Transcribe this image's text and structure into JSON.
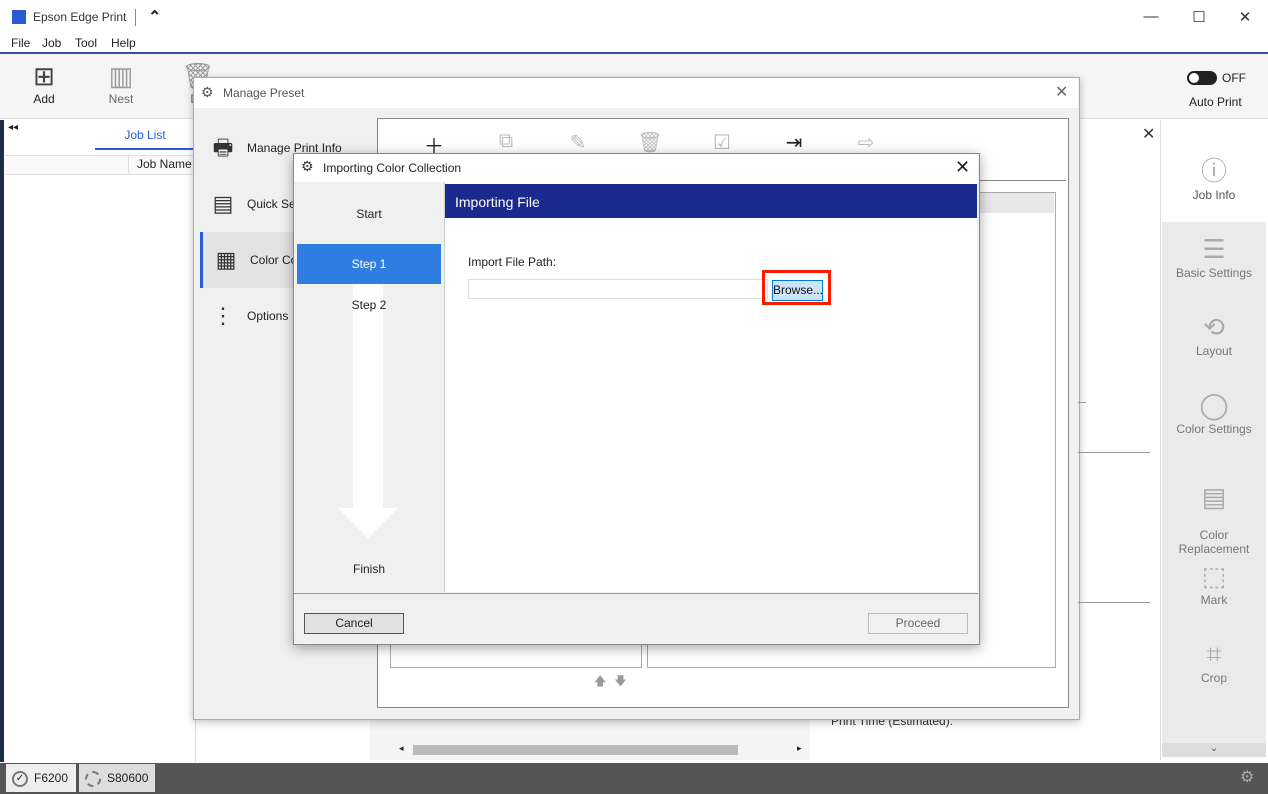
{
  "app": {
    "title": "Epson Edge Print",
    "menu": [
      "File",
      "Job",
      "Tool",
      "Help"
    ],
    "toolbar": {
      "add": "Add",
      "nest": "Nest",
      "delete_partial": "De"
    },
    "auto_print": {
      "toggle_state": "OFF",
      "label": "Auto Print"
    }
  },
  "job_list": {
    "tab": "Job List",
    "column_job_name": "Job Name"
  },
  "right_panel": {
    "items": [
      {
        "label": "Job Info",
        "icon": "job-info-icon"
      },
      {
        "label": "Basic Settings",
        "icon": "list-icon"
      },
      {
        "label": "Layout",
        "icon": "layout-icon"
      },
      {
        "label": "Color Settings",
        "icon": "color-ring-icon"
      },
      {
        "label": "Color\nReplacement",
        "icon": "color-replacement-icon"
      },
      {
        "label": "Mark",
        "icon": "mark-icon"
      },
      {
        "label": "Crop",
        "icon": "crop-icon"
      }
    ]
  },
  "background": {
    "print_time_label": "Print Time (Estimated):"
  },
  "status_bar": {
    "printers": [
      "F6200",
      "S80600"
    ]
  },
  "manage_preset": {
    "title": "Manage Preset",
    "nav": [
      {
        "label": "Manage Print Info",
        "icon": "printer-icon"
      },
      {
        "label": "Quick Se",
        "icon": "quick-settings-icon"
      },
      {
        "label": "Color Co",
        "icon": "color-collection-icon"
      },
      {
        "label": "Options",
        "icon": "more-options-icon"
      }
    ]
  },
  "import_dialog": {
    "title": "Importing Color Collection",
    "steps": {
      "start": "Start",
      "step1": "Step 1",
      "step2": "Step 2",
      "finish": "Finish"
    },
    "header": "Importing File",
    "path_label": "Import File Path:",
    "path_value": "",
    "browse_label": "Browse...",
    "cancel_label": "Cancel",
    "proceed_label": "Proceed"
  },
  "colors": {
    "header_bg": "#1b2a8f",
    "active_step": "#2f7de1",
    "highlight": "#ff1a00"
  }
}
